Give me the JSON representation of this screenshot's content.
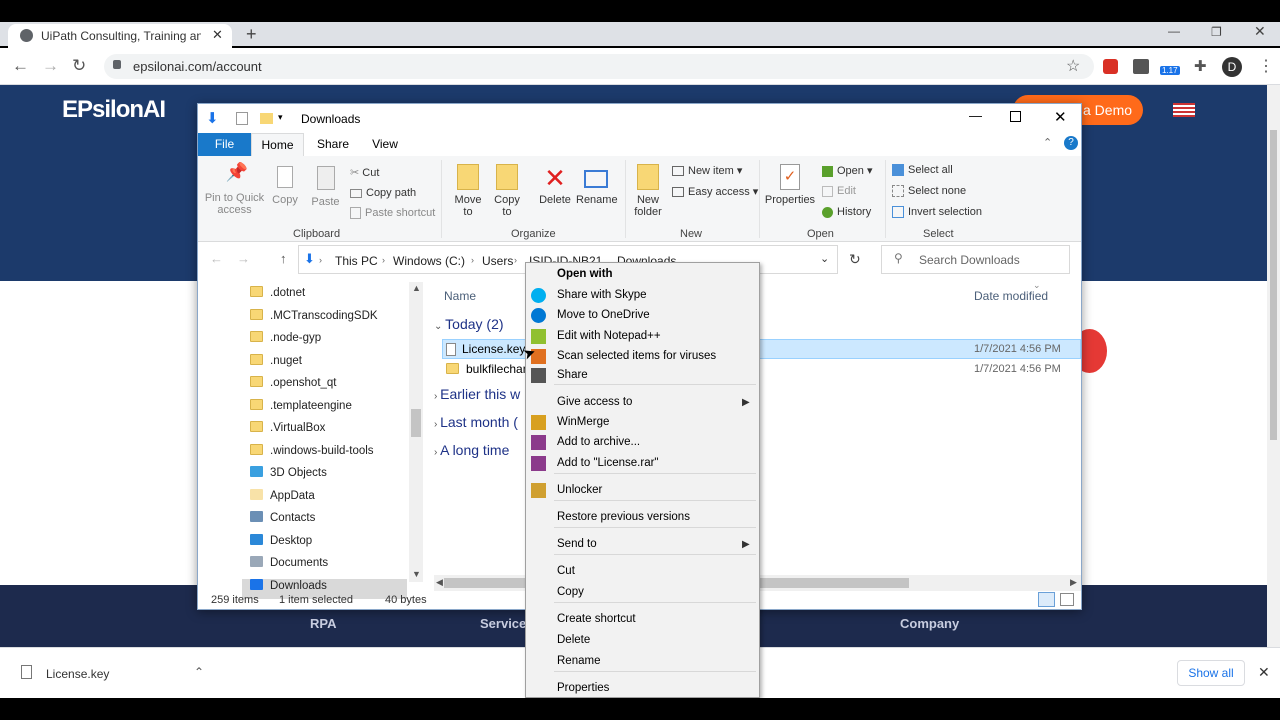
{
  "browser": {
    "tab_title": "UiPath Consulting, Training and I",
    "url": "epsilonai.com/account",
    "profile_initial": "D",
    "extension_badge": "1.17"
  },
  "site": {
    "logo": "EPsilonAI",
    "demo_button": "a Demo",
    "footer_links": [
      "RPA",
      "Service",
      "Company"
    ]
  },
  "explorer": {
    "title": "Downloads",
    "ribbon_tabs": [
      "File",
      "Home",
      "Share",
      "View"
    ],
    "groups": {
      "clipboard": "Clipboard",
      "organize": "Organize",
      "new": "New",
      "open": "Open",
      "select": "Select"
    },
    "buttons": {
      "pin": "Pin to Quick access",
      "copy": "Copy",
      "paste": "Paste",
      "cut": "Cut",
      "copy_path": "Copy path",
      "paste_shortcut": "Paste shortcut",
      "move_to": "Move to",
      "copy_to": "Copy to",
      "delete": "Delete",
      "rename": "Rename",
      "new_folder": "New folder",
      "new_item": "New item",
      "easy_access": "Easy access",
      "properties": "Properties",
      "open": "Open",
      "edit": "Edit",
      "history": "History",
      "select_all": "Select all",
      "select_none": "Select none",
      "invert_selection": "Invert selection"
    },
    "breadcrumb": [
      "This PC",
      "Windows (C:)",
      "Users",
      "ISID-ID-NB21",
      "Downloads"
    ],
    "search_placeholder": "Search Downloads",
    "tree": [
      ".dotnet",
      ".MCTranscodingSDK",
      ".node-gyp",
      ".nuget",
      ".openshot_qt",
      ".templateengine",
      ".VirtualBox",
      ".windows-build-tools",
      "3D Objects",
      "AppData",
      "Contacts",
      "Desktop",
      "Documents",
      "Downloads"
    ],
    "columns": {
      "name": "Name",
      "date": "Date modified"
    },
    "groups_list": [
      "Today (2)",
      "Earlier this w",
      "Last month (",
      "A long time"
    ],
    "files": [
      {
        "name": "License.key",
        "date": "1/7/2021 4:56 PM"
      },
      {
        "name": "bulkfilechan",
        "date": "1/7/2021 4:56 PM"
      }
    ],
    "status": {
      "items": "259 items",
      "selected": "1 item selected",
      "size": "40 bytes"
    }
  },
  "context_menu": [
    "Open with",
    "Share with Skype",
    "Move to OneDrive",
    "Edit with Notepad++",
    "Scan selected items for viruses",
    "Share",
    "Give access to",
    "WinMerge",
    "Add to archive...",
    "Add to \"License.rar\"",
    "Unlocker",
    "Restore previous versions",
    "Send to",
    "Cut",
    "Copy",
    "Create shortcut",
    "Delete",
    "Rename",
    "Properties"
  ],
  "download_bar": {
    "file": "License.key",
    "show_all": "Show all"
  }
}
